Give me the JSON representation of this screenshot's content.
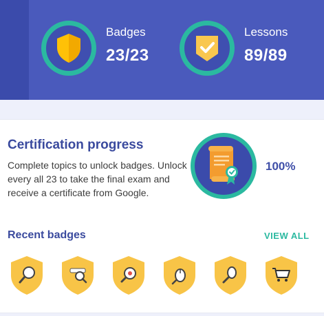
{
  "colors": {
    "header": "#4a5abc",
    "accent": "#2bb9a0",
    "title": "#3a4a9e",
    "badge": "#f8c447"
  },
  "stats": [
    {
      "label": "Badges",
      "value": "23/23",
      "icon": "shield-icon"
    },
    {
      "label": "Lessons",
      "value": "89/89",
      "icon": "check-shield-icon"
    }
  ],
  "certification": {
    "title": "Certification progress",
    "description": "Complete topics to unlock badges. Unlock every all 23 to take the final exam and receive a certificate from Google.",
    "percent": "100%",
    "icon": "certificate-scroll-icon"
  },
  "recent": {
    "title": "Recent badges",
    "view_all": "VIEW ALL",
    "badges": [
      {
        "icon": "magnifier-badge-icon"
      },
      {
        "icon": "search-magnifier-badge-icon"
      },
      {
        "icon": "magnifier-target-badge-icon"
      },
      {
        "icon": "mouse-magnifier-badge-icon"
      },
      {
        "icon": "magnifier-egg-badge-icon"
      },
      {
        "icon": "shopping-cart-badge-icon"
      }
    ]
  }
}
